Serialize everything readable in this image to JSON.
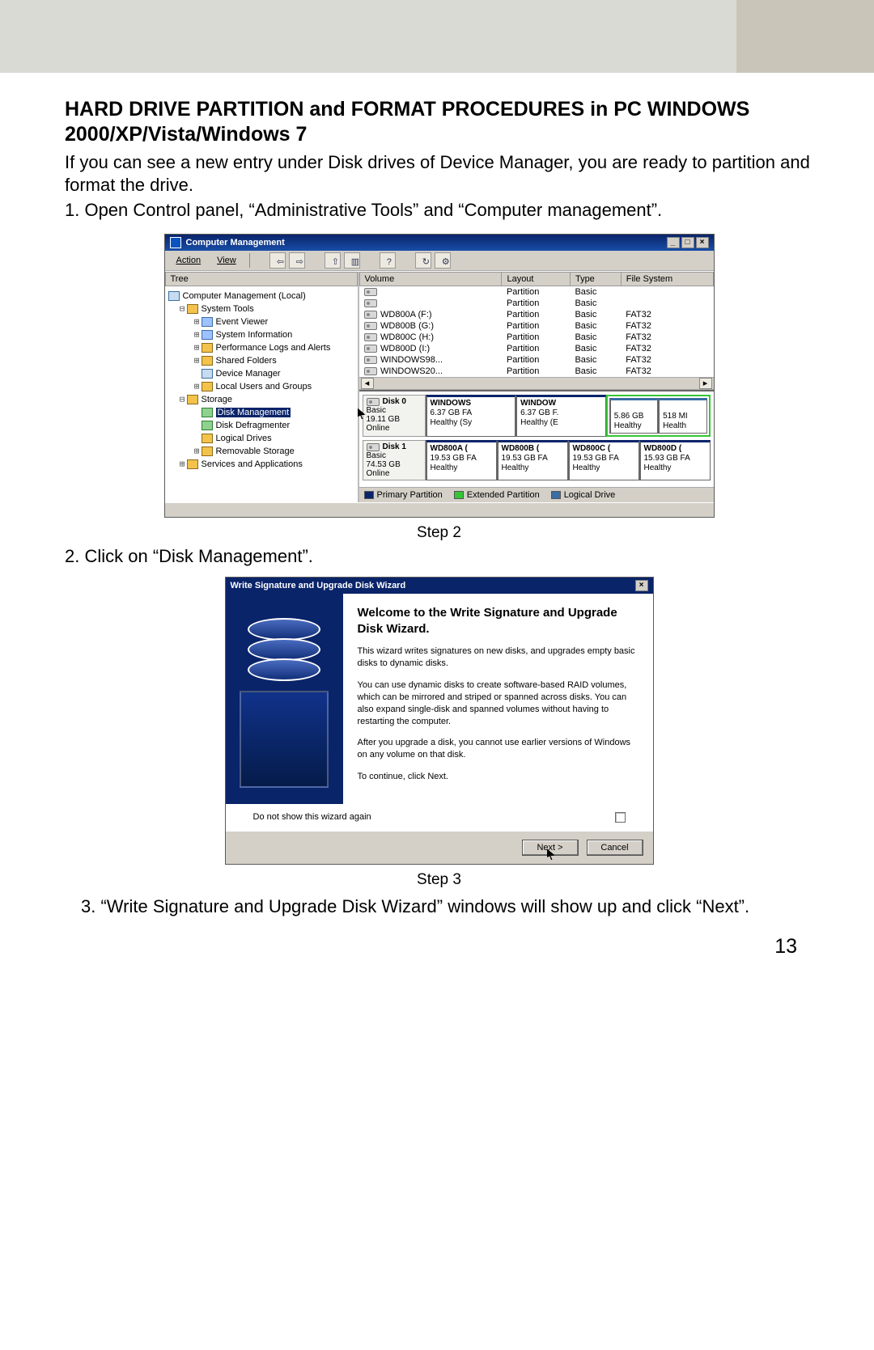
{
  "doc": {
    "title": "HARD DRIVE PARTITION and FORMAT PROCEDURES in PC WINDOWS 2000/XP/Vista/Windows 7",
    "intro": "If you can see a new entry under Disk drives of Device Manager, you are ready to partition and format the drive.",
    "step1": "1.  Open Control panel, “Administrative Tools” and “Computer management”.",
    "step2_caption": "Step 2",
    "step2": "2.  Click on “Disk Management”.",
    "step3_caption": "Step 3",
    "step3": "3.  “Write Signature and Upgrade Disk Wizard” windows will show up and click “Next”.",
    "page_num": "13"
  },
  "cm_window": {
    "title": "Computer Management",
    "menus": {
      "action": "Action",
      "view": "View"
    },
    "tree_header": "Tree",
    "tree": {
      "root": "Computer Management (Local)",
      "sys_tools": "System Tools",
      "sys_children": [
        "Event Viewer",
        "System Information",
        "Performance Logs and Alerts",
        "Shared Folders",
        "Device Manager",
        "Local Users and Groups"
      ],
      "storage": "Storage",
      "storage_children": [
        "Disk Management",
        "Disk Defragmenter",
        "Logical Drives",
        "Removable Storage"
      ],
      "services": "Services and Applications"
    },
    "vol_cols": {
      "volume": "Volume",
      "layout": "Layout",
      "type": "Type",
      "fs": "File System"
    },
    "vol_rows": [
      {
        "name": "",
        "layout": "Partition",
        "type": "Basic",
        "fs": ""
      },
      {
        "name": "",
        "layout": "Partition",
        "type": "Basic",
        "fs": ""
      },
      {
        "name": "WD800A (F:)",
        "layout": "Partition",
        "type": "Basic",
        "fs": "FAT32"
      },
      {
        "name": "WD800B (G:)",
        "layout": "Partition",
        "type": "Basic",
        "fs": "FAT32"
      },
      {
        "name": "WD800C (H:)",
        "layout": "Partition",
        "type": "Basic",
        "fs": "FAT32"
      },
      {
        "name": "WD800D (I:)",
        "layout": "Partition",
        "type": "Basic",
        "fs": "FAT32"
      },
      {
        "name": "WINDOWS98...",
        "layout": "Partition",
        "type": "Basic",
        "fs": "FAT32"
      },
      {
        "name": "WINDOWS20...",
        "layout": "Partition",
        "type": "Basic",
        "fs": "FAT32"
      }
    ],
    "disks": [
      {
        "name": "Disk 0",
        "kind": "Basic",
        "size": "19.11 GB",
        "status": "Online",
        "parts": [
          {
            "label": "WINDOWS",
            "size": "6.37 GB FA",
            "health": "Healthy (Sy",
            "cls": "primary"
          },
          {
            "label": "WINDOW",
            "size": "6.37 GB F.",
            "health": "Healthy (E",
            "cls": "primary"
          },
          {
            "label": "",
            "size": "5.86 GB",
            "health": "Healthy",
            "cls": "ext"
          },
          {
            "label": "",
            "size": "518 MI",
            "health": "Health",
            "cls": "ext"
          }
        ]
      },
      {
        "name": "Disk 1",
        "kind": "Basic",
        "size": "74.53 GB",
        "status": "Online",
        "parts": [
          {
            "label": "WD800A (",
            "size": "19.53 GB FA",
            "health": "Healthy",
            "cls": "primary"
          },
          {
            "label": "WD800B (",
            "size": "19.53 GB FA",
            "health": "Healthy",
            "cls": "primary"
          },
          {
            "label": "WD800C (",
            "size": "19.53 GB FA",
            "health": "Healthy",
            "cls": "primary"
          },
          {
            "label": "WD800D (",
            "size": "15.93 GB FA",
            "health": "Healthy",
            "cls": "primary"
          }
        ]
      }
    ],
    "legend": {
      "primary": "Primary Partition",
      "extended": "Extended Partition",
      "logical": "Logical Drive"
    }
  },
  "wizard": {
    "title": "Write Signature and Upgrade Disk Wizard",
    "heading": "Welcome to the Write Signature and Upgrade Disk Wizard.",
    "p1": "This wizard writes signatures on new disks, and upgrades empty basic disks to dynamic disks.",
    "p2": "You can use dynamic disks to create software-based RAID volumes, which can be mirrored and striped or spanned across disks. You can also expand single-disk and spanned volumes without having to restarting the computer.",
    "p3": "After you upgrade a disk, you cannot use earlier versions of Windows on any volume on that disk.",
    "p4": "To continue, click Next.",
    "dontshow": "Do not show this wizard again",
    "next": "Next >",
    "cancel": "Cancel"
  }
}
